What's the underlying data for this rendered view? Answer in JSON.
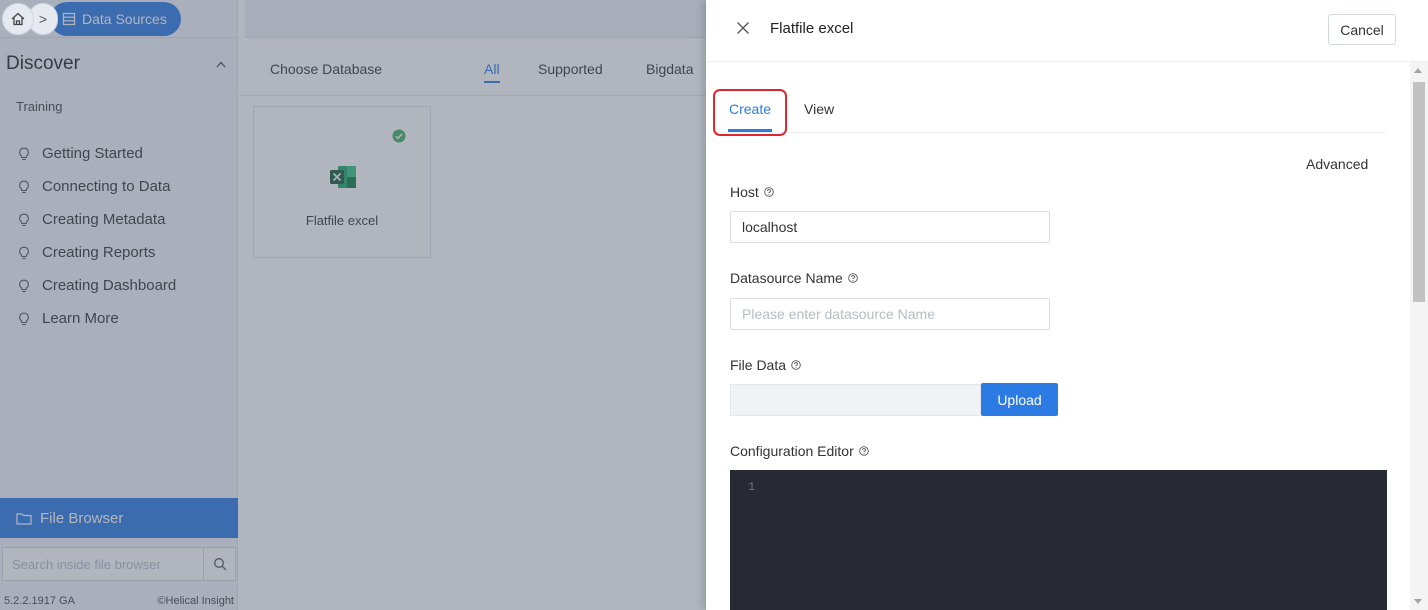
{
  "breadcrumb": {
    "home_icon": "home-icon",
    "separator": ">",
    "current_label": "Data Sources",
    "current_icon": "database-icon"
  },
  "sidebar": {
    "discover_title": "Discover",
    "discover_caret": "^",
    "section_label": "Training",
    "items": [
      {
        "label": "Getting Started",
        "icon": "lightbulb-icon"
      },
      {
        "label": "Connecting to Data",
        "icon": "lightbulb-icon"
      },
      {
        "label": "Creating Metadata",
        "icon": "lightbulb-icon"
      },
      {
        "label": "Creating Reports",
        "icon": "lightbulb-icon"
      },
      {
        "label": "Creating Dashboard",
        "icon": "lightbulb-icon"
      },
      {
        "label": "Learn More",
        "icon": "lightbulb-icon"
      }
    ],
    "file_browser_label": "File Browser",
    "search_placeholder": "Search inside file browser",
    "version": "5.2.2.1917 GA",
    "copyright": "©Helical Insight"
  },
  "main": {
    "choose_label": "Choose Database",
    "filter_tabs": [
      {
        "label": "All",
        "active": true
      },
      {
        "label": "Supported",
        "active": false
      },
      {
        "label": "Bigdata",
        "active": false
      }
    ],
    "card": {
      "name": "Flatfile excel",
      "icon": "excel-icon",
      "status_icon": "check-circle-icon"
    }
  },
  "drawer": {
    "title": "Flatfile excel",
    "close_icon": "close-icon",
    "cancel_label": "Cancel",
    "tabs": [
      {
        "label": "Create",
        "active": true
      },
      {
        "label": "View",
        "active": false
      }
    ],
    "advanced_label": "Advanced",
    "host": {
      "label": "Host",
      "value": "localhost"
    },
    "datasource_name": {
      "label": "Datasource Name",
      "value": "",
      "placeholder": "Please enter datasource Name"
    },
    "file_data": {
      "label": "File Data",
      "upload_label": "Upload"
    },
    "config_editor": {
      "label": "Configuration Editor",
      "line_number": "1"
    }
  },
  "colors": {
    "accent": "#2c7be5",
    "highlight": "#e0262c",
    "editor_bg": "#272a33",
    "success": "#3fb35b"
  }
}
